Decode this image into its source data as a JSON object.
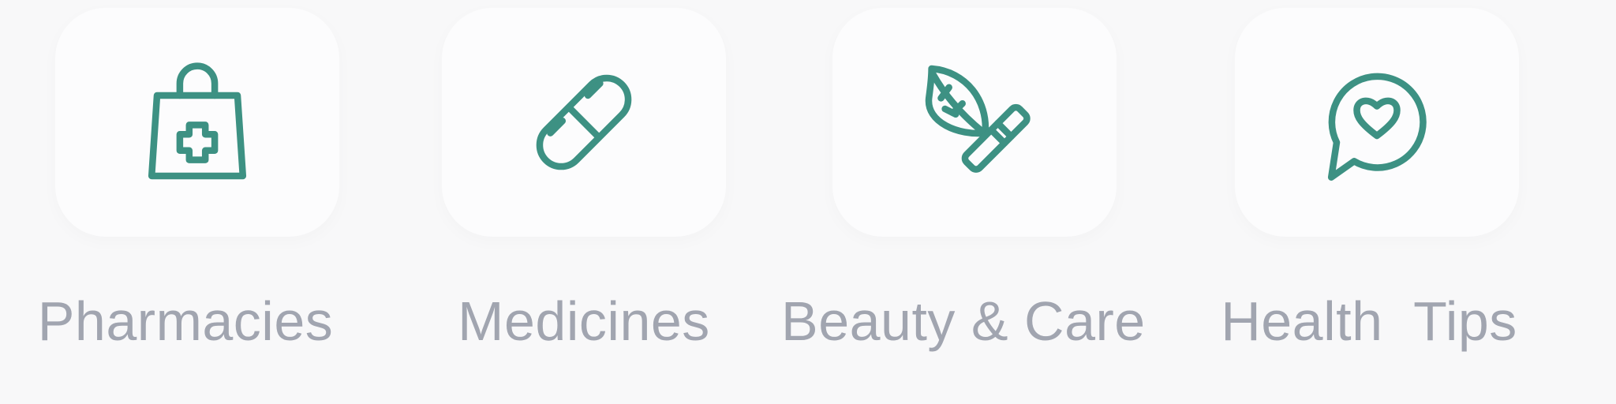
{
  "accent_color": "#3d9183",
  "label_color": "#a1a5b0",
  "categories": [
    {
      "label": "Pharmacies",
      "icon": "shopping-bag-medical-cross-icon"
    },
    {
      "label": "Medicines",
      "icon": "pill-capsule-icon"
    },
    {
      "label": "Beauty & Care",
      "icon": "leaf-cosmetic-tube-icon"
    },
    {
      "label": "Health  Tips",
      "icon": "chat-bubble-heart-icon"
    }
  ]
}
